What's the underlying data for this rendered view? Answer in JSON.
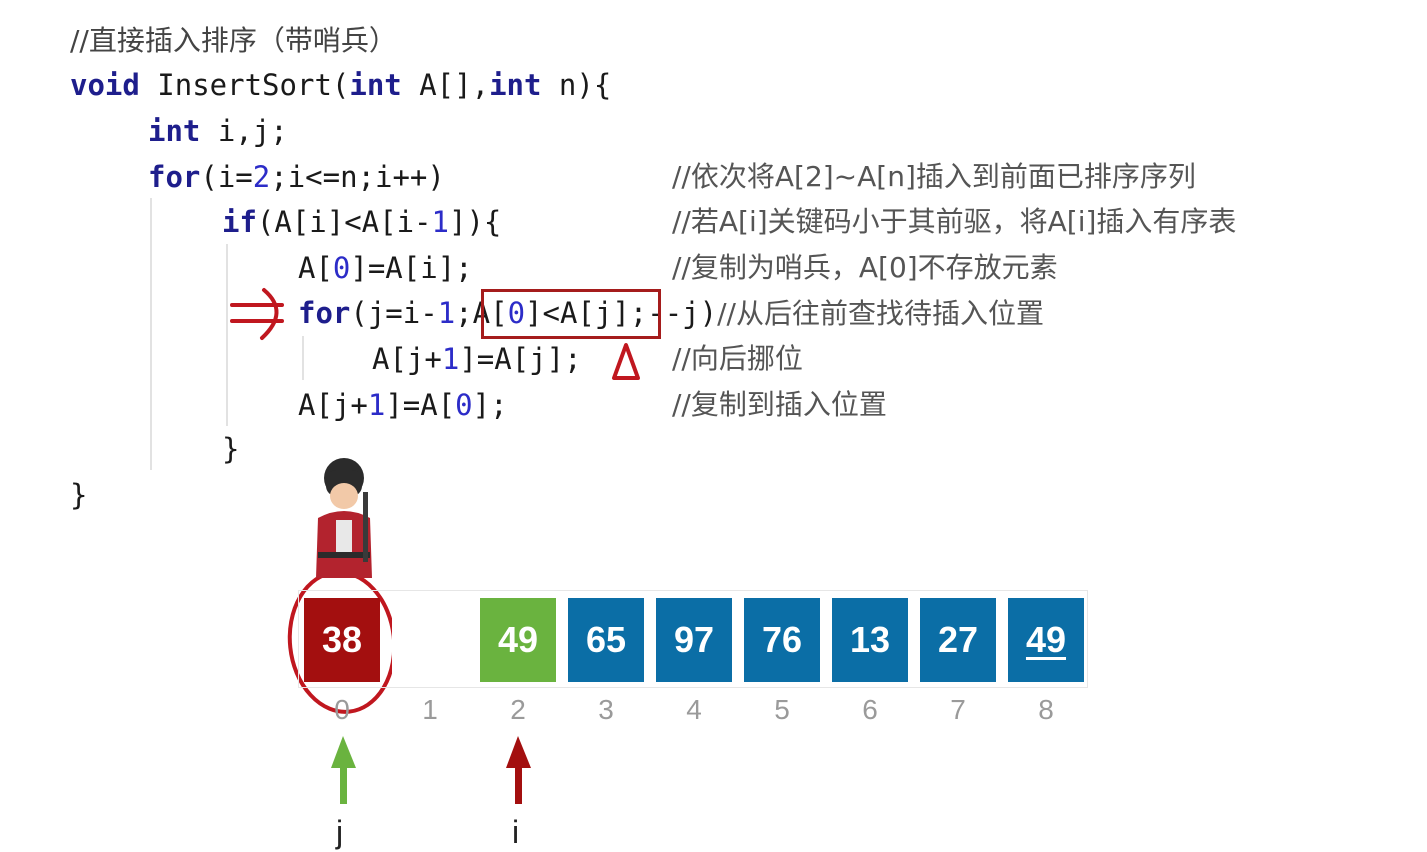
{
  "code": {
    "comment_header": "//直接插入排序（带哨兵）",
    "line_void": "void",
    "line_sig": " InsertSort(",
    "line_int1": "int",
    "line_sig2": " A[],",
    "line_int2": "int",
    "line_sig3": " n){",
    "decl_kw": "int",
    "decl_rest": " i,j;",
    "for1_kw": "for",
    "for1_a": "(i=",
    "for1_num": "2",
    "for1_b": ";i<=n;i++)",
    "for1_comment": "//依次将A[2]~A[n]插入到前面已排序序列",
    "if_kw": "if",
    "if_a": "(A[i]<A[i-",
    "if_num": "1",
    "if_b": "]){",
    "if_comment": "//若A[i]关键码小于其前驱，将A[i]插入有序表",
    "assign_a": "A[",
    "assign_num": "0",
    "assign_b": "]=A[i];",
    "assign_comment": "//复制为哨兵，A[0]不存放元素",
    "for2_kw": "for",
    "for2_a": "(j=i-",
    "for2_num": "1",
    "for2_b": ";",
    "for2_cond_a": "A[",
    "for2_cond_num": "0",
    "for2_cond_b": "]<A[j]",
    "for2_c": ";--j)",
    "for2_comment": "//从后往前查找待插入位置",
    "move_a": "A[j+",
    "move_num": "1",
    "move_b": "]=A[j];",
    "move_comment": "//向后挪位",
    "place_a": "A[j+",
    "place_num": "1",
    "place_b": "]=A[",
    "place_num2": "0",
    "place_c": "];",
    "place_comment": "//复制到插入位置",
    "close_inner": "}",
    "close_outer": "}"
  },
  "array": {
    "cells": [
      {
        "value": "38",
        "color": "#a30f0f",
        "underline": false
      },
      {
        "value": "",
        "color": "#ffffff",
        "underline": false
      },
      {
        "value": "49",
        "color": "#6ab33f",
        "underline": false
      },
      {
        "value": "65",
        "color": "#0b6ea6",
        "underline": false
      },
      {
        "value": "97",
        "color": "#0b6ea6",
        "underline": false
      },
      {
        "value": "76",
        "color": "#0b6ea6",
        "underline": false
      },
      {
        "value": "13",
        "color": "#0b6ea6",
        "underline": false
      },
      {
        "value": "27",
        "color": "#0b6ea6",
        "underline": false
      },
      {
        "value": "49",
        "color": "#0b6ea6",
        "underline": true
      }
    ],
    "indices": [
      "0",
      "1",
      "2",
      "3",
      "4",
      "5",
      "6",
      "7",
      "8"
    ]
  },
  "pointers": {
    "j_label": "j",
    "j_color": "#6ab33f",
    "i_label": "i",
    "i_color": "#a30f0f"
  },
  "annotations": {
    "ink_color": "#c0171f",
    "sentinel_icon": "guard-icon"
  }
}
